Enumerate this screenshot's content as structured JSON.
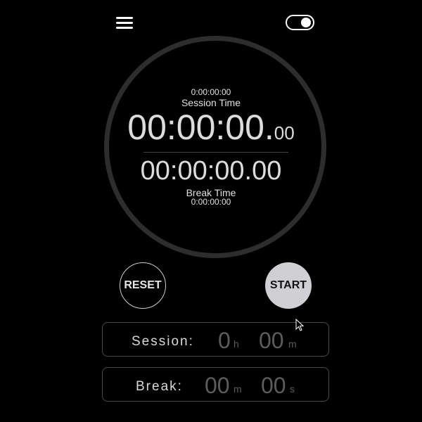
{
  "dial": {
    "session_total": "0:00:00:00",
    "session_label": "Session Time",
    "session_main": "00:00:00.",
    "session_frac": "00",
    "break_main": "00:00:00.00",
    "break_label": "Break Time",
    "break_total": "0:00:00:00"
  },
  "controls": {
    "reset_label": "RESET",
    "start_label": "START"
  },
  "session_input": {
    "label": "Session:",
    "hours_value": "0",
    "hours_unit": "h",
    "minutes_value": "00",
    "minutes_unit": "m"
  },
  "break_input": {
    "label": "Break:",
    "minutes_value": "00",
    "minutes_unit": "m",
    "seconds_value": "00",
    "seconds_unit": "s"
  },
  "icons": {
    "menu": "hamburger-menu-icon",
    "toggle": "toggle-switch-icon",
    "cursor": "mouse-pointer-icon"
  },
  "colors": {
    "background": "#000000",
    "dial_ring": "#2d2d2d",
    "start_button": "#d0d0d4",
    "muted_value": "#5c5c5c"
  },
  "toggle_state": "on"
}
